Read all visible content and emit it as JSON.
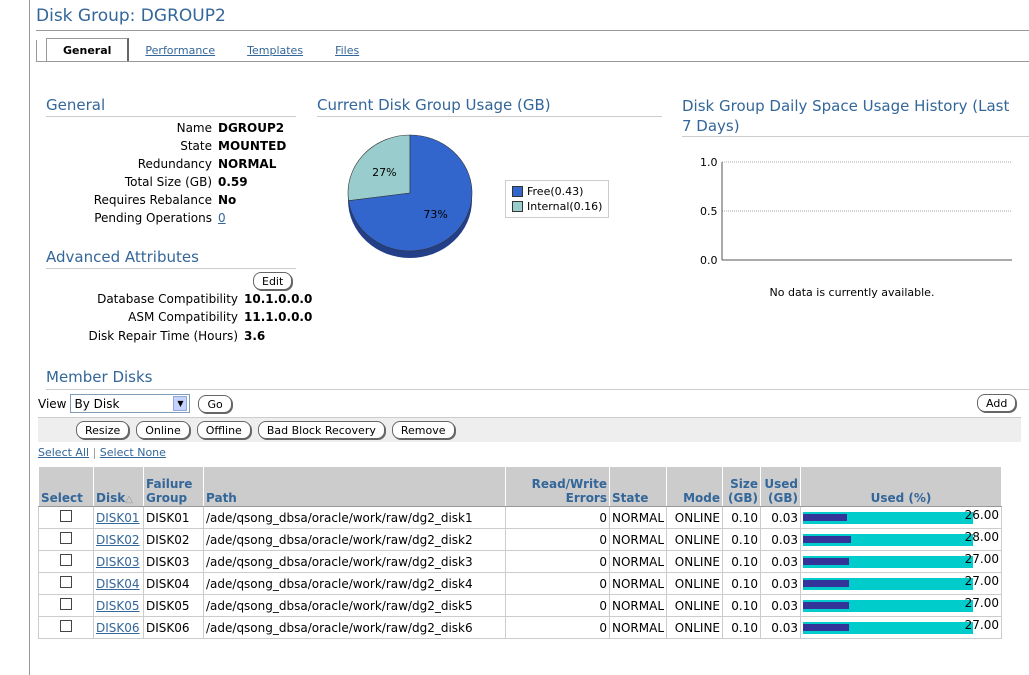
{
  "page": {
    "title": "Disk Group: DGROUP2"
  },
  "tabs": [
    {
      "label": "General",
      "active": true
    },
    {
      "label": "Performance"
    },
    {
      "label": "Templates"
    },
    {
      "label": "Files"
    }
  ],
  "general": {
    "heading": "General",
    "fields": [
      {
        "label": "Name",
        "value": "DGROUP2"
      },
      {
        "label": "State",
        "value": "MOUNTED"
      },
      {
        "label": "Redundancy",
        "value": "NORMAL"
      },
      {
        "label": "Total Size (GB)",
        "value": "0.59"
      },
      {
        "label": "Requires Rebalance",
        "value": "No"
      },
      {
        "label": "Pending Operations",
        "value": "0"
      }
    ]
  },
  "advanced": {
    "heading": "Advanced Attributes",
    "edit_label": "Edit",
    "fields": [
      {
        "label": "Database Compatibility",
        "value": "10.1.0.0.0"
      },
      {
        "label": "ASM Compatibility",
        "value": "11.1.0.0.0"
      },
      {
        "label": "Disk Repair Time (Hours)",
        "value": "3.6"
      }
    ]
  },
  "usage": {
    "heading": "Current Disk Group Usage (GB)",
    "slice_labels": [
      "73%",
      "27%"
    ],
    "legend": [
      "Free(0.43)",
      "Internal(0.16)"
    ],
    "colors": {
      "free": "#3366cc",
      "internal": "#99cccc"
    }
  },
  "chart_data": [
    {
      "type": "pie",
      "title": "Current Disk Group Usage (GB)",
      "categories": [
        "Free",
        "Internal"
      ],
      "values": [
        0.43,
        0.16
      ],
      "labels": [
        "73%",
        "27%"
      ],
      "legend": [
        "Free(0.43)",
        "Internal(0.16)"
      ],
      "legend_position": "right"
    },
    {
      "type": "line",
      "title": "Disk Group Daily Space Usage History (Last 7 Days)",
      "y_ticks": [
        "1.0",
        "0.5",
        "0.0"
      ],
      "ylim": [
        0,
        1
      ],
      "series": [],
      "grid": true,
      "message": "No data is currently available."
    }
  ],
  "history": {
    "heading": "Disk Group Daily Space Usage History (Last 7 Days)",
    "y_ticks": [
      "1.0",
      "0.5",
      "0.0"
    ],
    "empty_message": "No data is currently available."
  },
  "members": {
    "heading": "Member Disks",
    "view_label": "View",
    "view_value": "By Disk",
    "go_label": "Go",
    "add_label": "Add",
    "actions": [
      "Resize",
      "Online",
      "Offline",
      "Bad Block Recovery",
      "Remove"
    ],
    "select_all": "Select All",
    "select_none": "Select None",
    "columns": {
      "select": "Select",
      "disk": "Disk",
      "failure_group": [
        "Failure",
        "Group"
      ],
      "path": "Path",
      "rw_errors": [
        "Read/Write",
        "Errors"
      ],
      "state": "State",
      "mode": "Mode",
      "size": [
        "Size",
        "(GB)"
      ],
      "used": [
        "Used",
        "(GB)"
      ],
      "used_pct": "Used (%)"
    },
    "rows": [
      {
        "disk": "DISK01",
        "fg": "DISK01",
        "path": "/ade/qsong_dbsa/oracle/work/raw/dg2_disk1",
        "errors": "0",
        "state": "NORMAL",
        "mode": "ONLINE",
        "size": "0.10",
        "used": "0.03",
        "pct": "26.00",
        "pct_value": 26.0
      },
      {
        "disk": "DISK02",
        "fg": "DISK02",
        "path": "/ade/qsong_dbsa/oracle/work/raw/dg2_disk2",
        "errors": "0",
        "state": "NORMAL",
        "mode": "ONLINE",
        "size": "0.10",
        "used": "0.03",
        "pct": "28.00",
        "pct_value": 28.0
      },
      {
        "disk": "DISK03",
        "fg": "DISK03",
        "path": "/ade/qsong_dbsa/oracle/work/raw/dg2_disk3",
        "errors": "0",
        "state": "NORMAL",
        "mode": "ONLINE",
        "size": "0.10",
        "used": "0.03",
        "pct": "27.00",
        "pct_value": 27.0
      },
      {
        "disk": "DISK04",
        "fg": "DISK04",
        "path": "/ade/qsong_dbsa/oracle/work/raw/dg2_disk4",
        "errors": "0",
        "state": "NORMAL",
        "mode": "ONLINE",
        "size": "0.10",
        "used": "0.03",
        "pct": "27.00",
        "pct_value": 27.0
      },
      {
        "disk": "DISK05",
        "fg": "DISK05",
        "path": "/ade/qsong_dbsa/oracle/work/raw/dg2_disk5",
        "errors": "0",
        "state": "NORMAL",
        "mode": "ONLINE",
        "size": "0.10",
        "used": "0.03",
        "pct": "27.00",
        "pct_value": 27.0
      },
      {
        "disk": "DISK06",
        "fg": "DISK06",
        "path": "/ade/qsong_dbsa/oracle/work/raw/dg2_disk6",
        "errors": "0",
        "state": "NORMAL",
        "mode": "ONLINE",
        "size": "0.10",
        "used": "0.03",
        "pct": "27.00",
        "pct_value": 27.0
      }
    ]
  }
}
